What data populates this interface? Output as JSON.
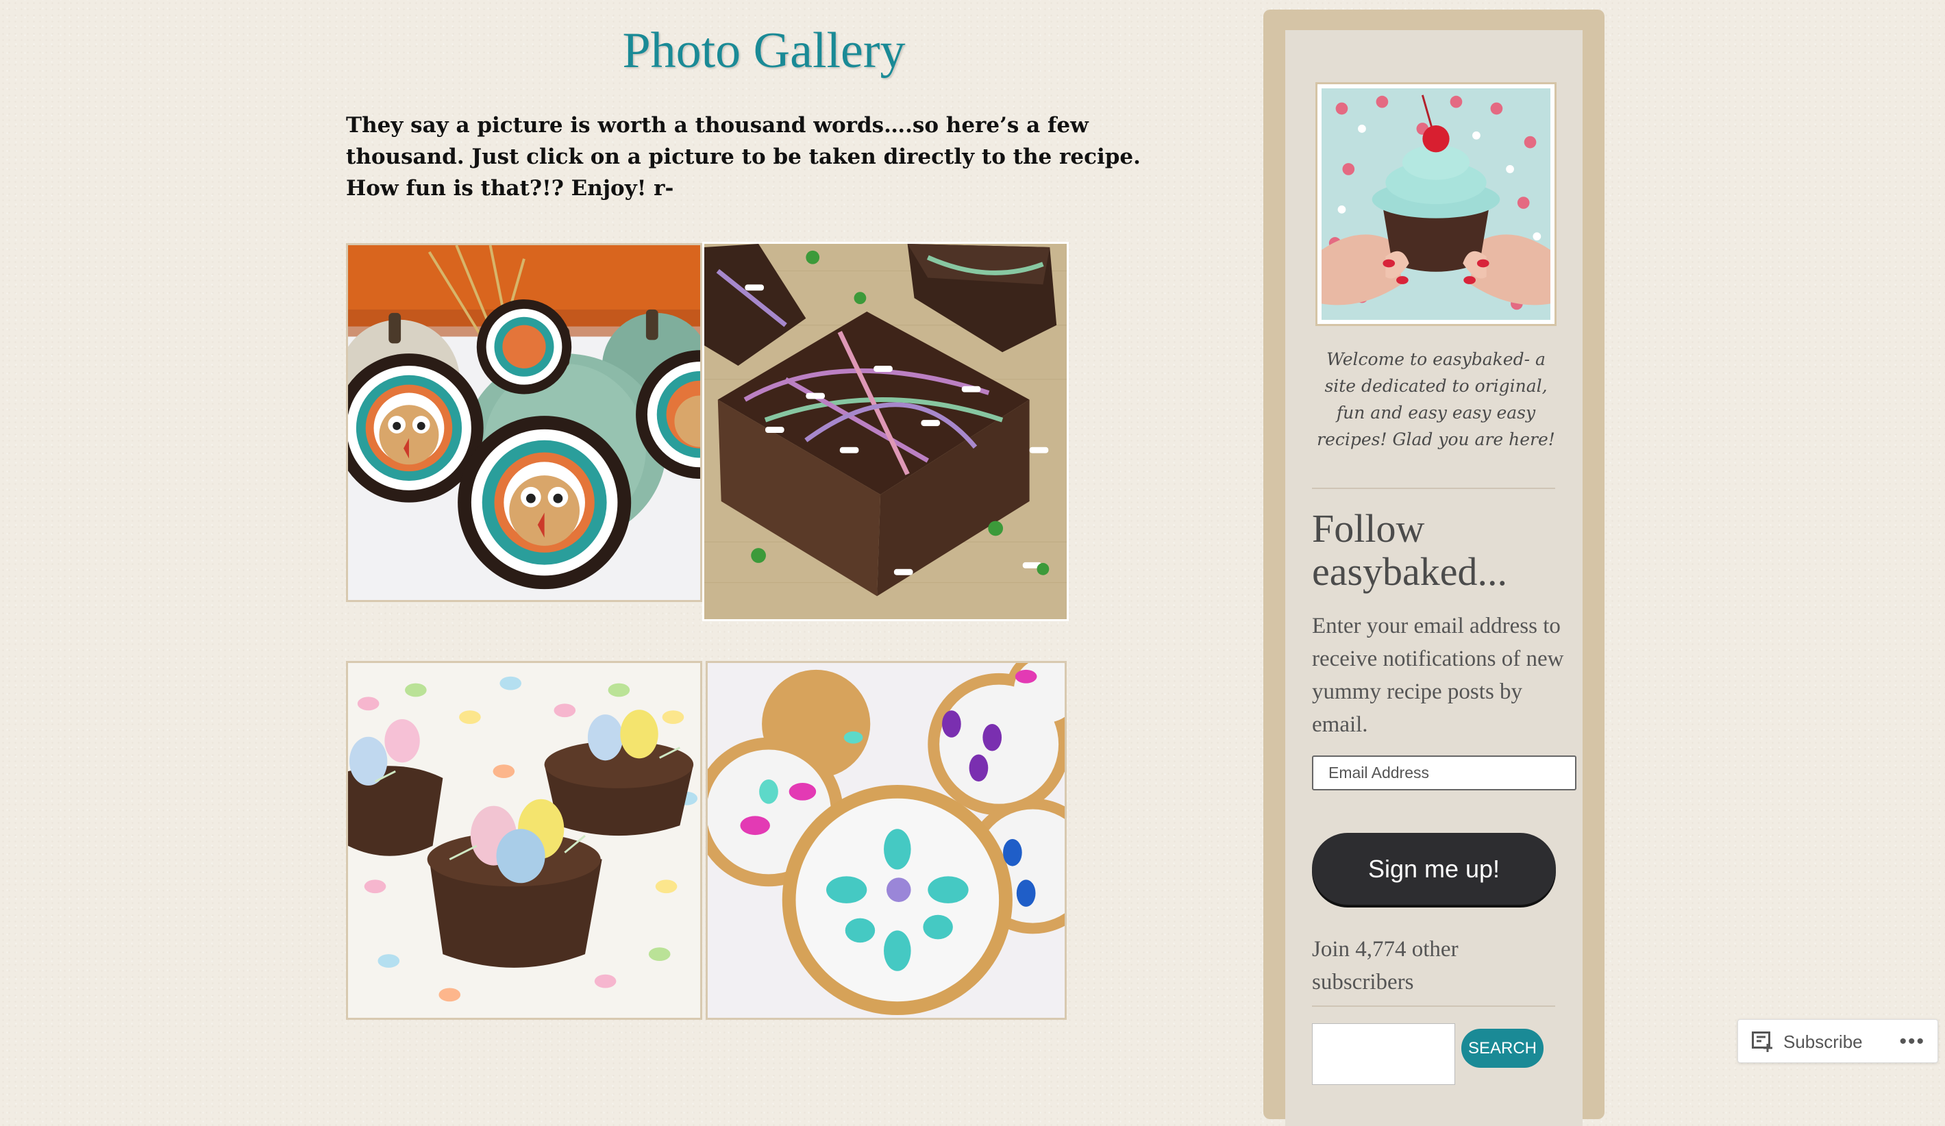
{
  "page": {
    "title": "Photo Gallery",
    "intro": "They say a picture is worth a thousand words….so here’s a few thousand.  Just click on a picture to be taken directly to the recipe.  How fun is that?!?   Enjoy!  r-"
  },
  "gallery": [
    {
      "name": "turkey-cookies",
      "alt": "Turkey cookies with pumpkins"
    },
    {
      "name": "halloween-brownies",
      "alt": "Splatter brownies with bone sprinkles"
    },
    {
      "name": "easter-nests",
      "alt": "Chocolate nests with candy eggs"
    },
    {
      "name": "easter-cookies",
      "alt": "Iced sugar cookies with jelly beans"
    }
  ],
  "sidebar": {
    "welcome": "Welcome to easybaked- a site dedicated to original, fun and easy easy easy recipes!  Glad you are here!",
    "follow_title": "Follow easybaked...",
    "follow_desc": "Enter your email address to receive notifications of new yummy recipe posts by email.",
    "email_placeholder": "Email Address",
    "signup_label": "Sign me up!",
    "join_text": "Join 4,774 other subscribers",
    "search_label": "SEARCH"
  },
  "subscribe_bar": {
    "subscribe_label": "Subscribe",
    "more_label": "•••"
  },
  "colors": {
    "accent": "#1a8a96",
    "button_dark": "#2d2d30",
    "sidebar_frame": "#d5c4a6"
  }
}
